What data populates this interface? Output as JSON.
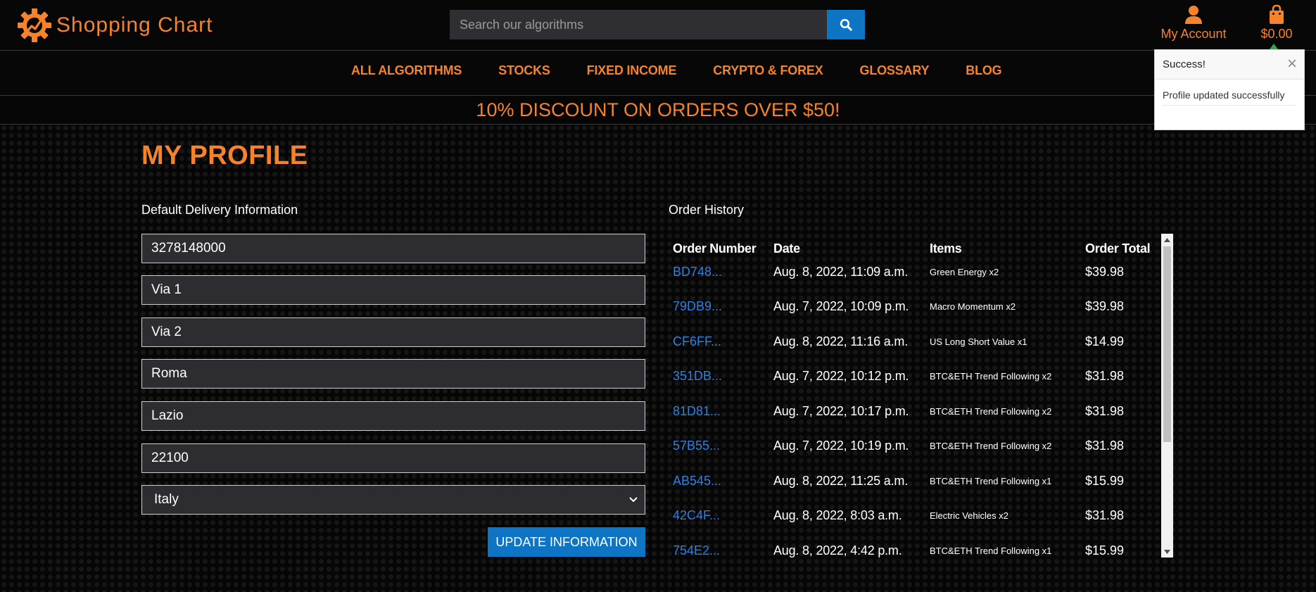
{
  "brand": {
    "name": "Shopping Chart"
  },
  "search": {
    "placeholder": "Search our algorithms",
    "icon": "search-icon"
  },
  "header": {
    "account_label": "My Account",
    "cart_total": "$0.00"
  },
  "nav": {
    "items": [
      "ALL ALGORITHMS",
      "STOCKS",
      "FIXED INCOME",
      "CRYPTO & FOREX",
      "GLOSSARY",
      "BLOG"
    ]
  },
  "promo": {
    "text": "10% DISCOUNT ON ORDERS OVER $50!"
  },
  "profile": {
    "title": "MY PROFILE",
    "delivery_heading": "Default Delivery Information",
    "fields": [
      "3278148000",
      "Via 1",
      "Via 2",
      "Roma",
      "Lazio",
      "22100"
    ],
    "country": "Italy",
    "update_label": "UPDATE INFORMATION"
  },
  "orders": {
    "heading": "Order History",
    "columns": [
      "Order Number",
      "Date",
      "Items",
      "Order Total"
    ],
    "rows": [
      {
        "number": "BD748...",
        "date": "Aug. 8, 2022, 11:09 a.m.",
        "items": "Green Energy x2",
        "total": "$39.98"
      },
      {
        "number": "79DB9...",
        "date": "Aug. 7, 2022, 10:09 p.m.",
        "items": "Macro Momentum x2",
        "total": "$39.98"
      },
      {
        "number": "CF6FF...",
        "date": "Aug. 8, 2022, 11:16 a.m.",
        "items": "US Long Short Value x1",
        "total": "$14.99"
      },
      {
        "number": "351DB...",
        "date": "Aug. 7, 2022, 10:12 p.m.",
        "items": "BTC&ETH Trend Following x2",
        "total": "$31.98"
      },
      {
        "number": "81D81...",
        "date": "Aug. 7, 2022, 10:17 p.m.",
        "items": "BTC&ETH Trend Following x2",
        "total": "$31.98"
      },
      {
        "number": "57B55...",
        "date": "Aug. 7, 2022, 10:19 p.m.",
        "items": "BTC&ETH Trend Following x2",
        "total": "$31.98"
      },
      {
        "number": "AB545...",
        "date": "Aug. 8, 2022, 11:25 a.m.",
        "items": "BTC&ETH Trend Following x1",
        "total": "$15.99"
      },
      {
        "number": "42C4F...",
        "date": "Aug. 8, 2022, 8:03 a.m.",
        "items": "Electric Vehicles x2",
        "total": "$31.98"
      },
      {
        "number": "754E2...",
        "date": "Aug. 8, 2022, 4:42 p.m.",
        "items": "BTC&ETH Trend Following x1",
        "total": "$15.99"
      }
    ]
  },
  "toast": {
    "title": "Success!",
    "message": "Profile updated successfully",
    "close_symbol": "×"
  },
  "colors": {
    "accent": "#f5832b",
    "primary_button": "#0d75c4",
    "link": "#2f7fe0",
    "background": "#060606",
    "field_bg": "#2d2d31",
    "cart_indicator": "#2aa845"
  }
}
